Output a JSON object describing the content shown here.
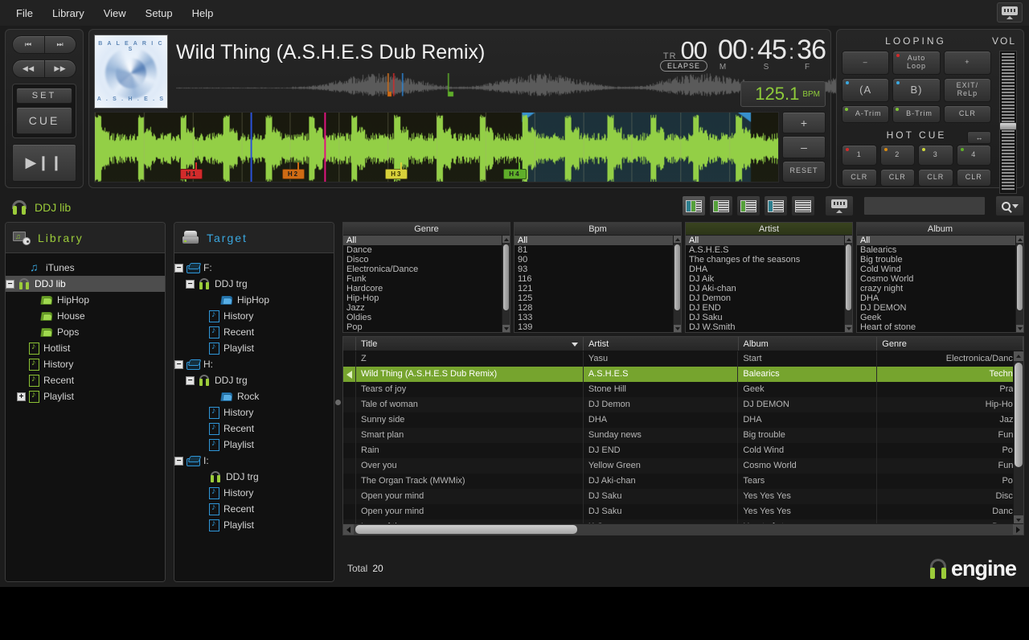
{
  "menu": {
    "items": [
      "File",
      "Library",
      "View",
      "Setup",
      "Help"
    ],
    "window_icon": "keyboard-icon"
  },
  "deck": {
    "transport": {
      "prev_track": "⏮",
      "next_track": "⏭",
      "rew": "◀◀",
      "ffwd": "▶▶",
      "set": "SET",
      "cue": "CUE",
      "play_pause": "▶❙❙"
    },
    "album_art": {
      "top_text": "B A L E A R I C S",
      "bottom_text": "A . S . H . E . S"
    },
    "track_title": "Wild Thing (A.S.H.E.S Dub Remix)",
    "time": {
      "tr_label": "TR",
      "tr_value": "00",
      "minutes": "00",
      "seconds": "45",
      "frames": "36",
      "colon": ":",
      "m_label": "M",
      "s_label": "S",
      "f_label": "F",
      "mode": "ELAPSE"
    },
    "bpm": {
      "value": "125.1",
      "label": "BPM"
    },
    "zoom": {
      "plus": "+",
      "minus": "–",
      "reset": "RESET"
    },
    "hot_cues_on_wave": [
      {
        "label": "H1",
        "color": "#d22b2b",
        "pos": 12.5
      },
      {
        "label": "H2",
        "color": "#cf6b14",
        "pos": 27.4
      },
      {
        "label": "H3",
        "color": "#d8d13a",
        "pos": 42.5
      },
      {
        "label": "H4",
        "color": "#5fae2a",
        "pos": 59.8
      }
    ],
    "overview_markers": [
      {
        "color": "#cf6b14",
        "pos": 29.2
      },
      {
        "color": "#d22b2b",
        "pos": 30.0
      },
      {
        "color": "#2e86d6",
        "pos": 31.2
      },
      {
        "color": "#5fae2a",
        "pos": 37.5
      }
    ]
  },
  "right_panel": {
    "looping_title": "LOOPING",
    "vol_title": "VOL",
    "hotcue_title": "HOT CUE",
    "buttons": {
      "minus": "–",
      "auto_loop": "Auto\nLoop",
      "plus": "+",
      "loop_in": "(A",
      "loop_out": "B)",
      "exit_reloop": "EXIT/\nReLp",
      "a_trim": "A-Trim",
      "b_trim": "B-Trim",
      "clr": "CLR"
    },
    "hot_cue_buttons": [
      {
        "num": "1",
        "led": "#d22b2b",
        "clear": "CLR"
      },
      {
        "num": "2",
        "led": "#d98b12",
        "clear": "CLR"
      },
      {
        "num": "3",
        "led": "#cdd63c",
        "clear": "CLR"
      },
      {
        "num": "4",
        "led": "#5fae2a",
        "clear": "CLR"
      }
    ],
    "hotcue_toggle": "↔"
  },
  "lib_header": {
    "title": "DDJ lib",
    "view_buttons": [
      "view-1",
      "view-2",
      "view-3",
      "view-4",
      "view-5"
    ],
    "keyboard_button": "keyboard-icon",
    "search_value": "",
    "search_placeholder": "",
    "search_icon": "search-icon"
  },
  "library_tree": {
    "header": "Library",
    "items": [
      {
        "label": "iTunes",
        "icon": "music-note-icon",
        "indent": 2,
        "expander": "",
        "selected": false
      },
      {
        "label": "DDJ lib",
        "icon": "headphones-icon",
        "indent": 1,
        "expander": "−",
        "selected": true
      },
      {
        "label": "HipHop",
        "icon": "stack-green-icon",
        "indent": 3,
        "expander": "",
        "selected": false
      },
      {
        "label": "House",
        "icon": "stack-green-icon",
        "indent": 3,
        "expander": "",
        "selected": false
      },
      {
        "label": "Pops",
        "icon": "stack-green-icon",
        "indent": 3,
        "expander": "",
        "selected": false
      },
      {
        "label": "Hotlist",
        "icon": "playlist-green-icon",
        "indent": 2,
        "expander": "",
        "selected": false
      },
      {
        "label": "History",
        "icon": "playlist-green-icon",
        "indent": 2,
        "expander": "",
        "selected": false
      },
      {
        "label": "Recent",
        "icon": "playlist-green-icon",
        "indent": 2,
        "expander": "",
        "selected": false
      },
      {
        "label": "Playlist",
        "icon": "playlist-green-icon",
        "indent": 2,
        "expander": "+",
        "selected": false
      }
    ]
  },
  "target_tree": {
    "header": "Target",
    "items": [
      {
        "label": "F:",
        "icon": "drive-icon",
        "indent": 1,
        "expander": "−"
      },
      {
        "label": "DDJ trg",
        "icon": "headphones-icon",
        "indent": 2,
        "expander": "−"
      },
      {
        "label": "HipHop",
        "icon": "stack-blue-icon",
        "indent": 4,
        "expander": ""
      },
      {
        "label": "History",
        "icon": "playlist-blue-icon",
        "indent": 3,
        "expander": ""
      },
      {
        "label": "Recent",
        "icon": "playlist-blue-icon",
        "indent": 3,
        "expander": ""
      },
      {
        "label": "Playlist",
        "icon": "playlist-blue-icon",
        "indent": 3,
        "expander": ""
      },
      {
        "label": "H:",
        "icon": "drive-icon",
        "indent": 1,
        "expander": "−"
      },
      {
        "label": "DDJ trg",
        "icon": "headphones-icon",
        "indent": 2,
        "expander": "−"
      },
      {
        "label": "Rock",
        "icon": "stack-blue-icon",
        "indent": 4,
        "expander": ""
      },
      {
        "label": "History",
        "icon": "playlist-blue-icon",
        "indent": 3,
        "expander": ""
      },
      {
        "label": "Recent",
        "icon": "playlist-blue-icon",
        "indent": 3,
        "expander": ""
      },
      {
        "label": "Playlist",
        "icon": "playlist-blue-icon",
        "indent": 3,
        "expander": ""
      },
      {
        "label": "I:",
        "icon": "drive-icon",
        "indent": 1,
        "expander": "−"
      },
      {
        "label": "DDJ trg",
        "icon": "headphones-icon",
        "indent": 3,
        "expander": ""
      },
      {
        "label": "History",
        "icon": "playlist-blue-icon",
        "indent": 3,
        "expander": ""
      },
      {
        "label": "Recent",
        "icon": "playlist-blue-icon",
        "indent": 3,
        "expander": ""
      },
      {
        "label": "Playlist",
        "icon": "playlist-blue-icon",
        "indent": 3,
        "expander": ""
      }
    ]
  },
  "filters": [
    {
      "title": "Genre",
      "active": false,
      "items": [
        "All",
        "Dance",
        "Disco",
        "Electronica/Dance",
        "Funk",
        "Hardcore",
        "Hip-Hop",
        "Jazz",
        "Oldies",
        "Pop"
      ],
      "selected_index": 0
    },
    {
      "title": "Bpm",
      "active": false,
      "items": [
        "All",
        "81",
        "90",
        "93",
        "116",
        "121",
        "125",
        "128",
        "133",
        "139"
      ],
      "selected_index": 0
    },
    {
      "title": "Artist",
      "active": true,
      "items": [
        "All",
        "A.S.H.E.S",
        "The changes of the seasons",
        "DHA",
        "DJ Aik",
        "DJ Aki-chan",
        "DJ Demon",
        "DJ END",
        "DJ Saku",
        "DJ W.Smith"
      ],
      "selected_index": 0
    },
    {
      "title": "Album",
      "active": false,
      "items": [
        "All",
        "Balearics",
        "Big trouble",
        "Cold Wind",
        "Cosmo World",
        "crazy night",
        "DHA",
        "DJ DEMON",
        "Geek",
        "Heart of stone"
      ],
      "selected_index": 0
    }
  ],
  "track_table": {
    "columns": [
      "",
      "Title",
      "Artist",
      "Album",
      "Genre"
    ],
    "sorted_column": "Title",
    "rows": [
      {
        "playing": false,
        "title": "Z",
        "artist": "Yasu",
        "album": "Start",
        "genre": "Electronica/Dance"
      },
      {
        "playing": true,
        "title": "Wild Thing (A.S.H.E.S Dub Remix)",
        "artist": "A.S.H.E.S",
        "album": "Balearics",
        "genre": "Techno"
      },
      {
        "playing": false,
        "title": "Tears of joy",
        "artist": "Stone Hill",
        "album": "Geek",
        "genre": "Pray"
      },
      {
        "playing": false,
        "title": "Tale of woman",
        "artist": "DJ Demon",
        "album": "DJ DEMON",
        "genre": "Hip-Hop"
      },
      {
        "playing": false,
        "title": "Sunny side",
        "artist": "DHA",
        "album": "DHA",
        "genre": "Jazz"
      },
      {
        "playing": false,
        "title": "Smart plan",
        "artist": "Sunday news",
        "album": "Big trouble",
        "genre": "Funk"
      },
      {
        "playing": false,
        "title": "Rain",
        "artist": "DJ END",
        "album": "Cold Wind",
        "genre": "Pop"
      },
      {
        "playing": false,
        "title": "Over you",
        "artist": "Yellow Green",
        "album": "Cosmo World",
        "genre": "Funk"
      },
      {
        "playing": false,
        "title": "The Organ Track (MWMix)",
        "artist": "DJ Aki-chan",
        "album": "Tears",
        "genre": "Pop"
      },
      {
        "playing": false,
        "title": "Open your mind",
        "artist": "DJ Saku",
        "album": "Yes Yes Yes",
        "genre": "Disco"
      },
      {
        "playing": false,
        "title": "Open your mind",
        "artist": "DJ Saku",
        "album": "Yes Yes Yes",
        "genre": "Dance"
      },
      {
        "playing": false,
        "title": "Love of the power",
        "artist": "K.O",
        "album": "Heart of stone",
        "genre": "Dance"
      }
    ]
  },
  "footer": {
    "total_label": "Total",
    "total_value": "20",
    "logo_text": "engine"
  }
}
